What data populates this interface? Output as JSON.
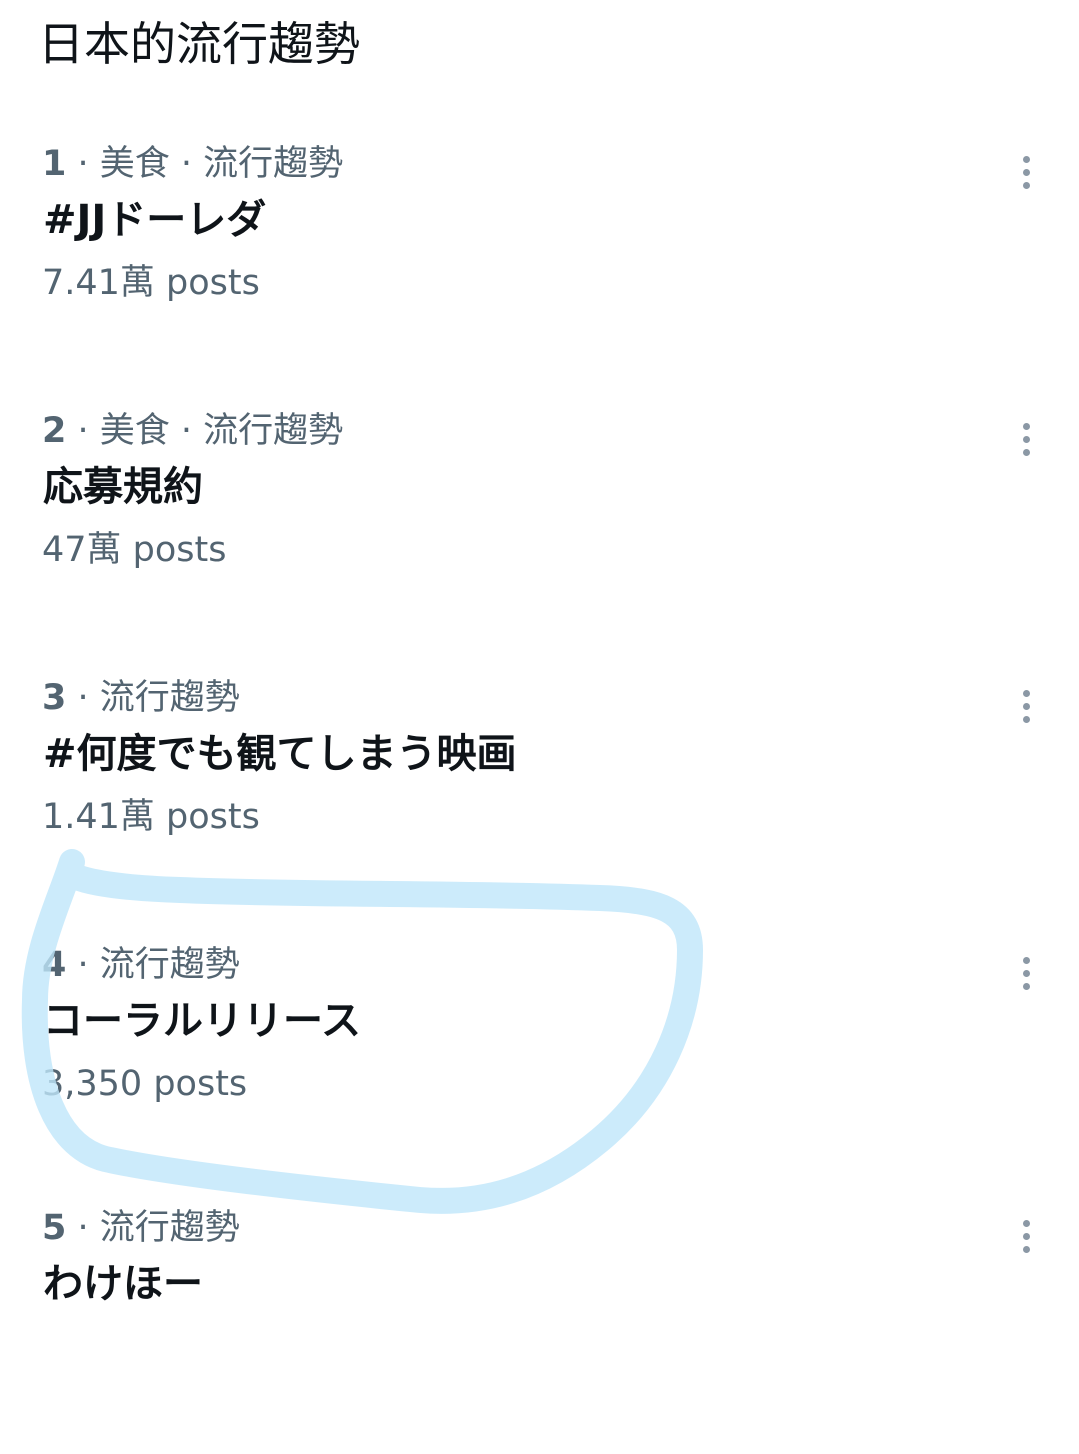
{
  "header": {
    "title": "日本的流行趨勢"
  },
  "trends": [
    {
      "rank": "1",
      "context": "美食 · 流行趨勢",
      "name": "#JJドーレダ",
      "posts": "7.41萬 posts"
    },
    {
      "rank": "2",
      "context": "美食 · 流行趨勢",
      "name": "応募規約",
      "posts": "47萬 posts"
    },
    {
      "rank": "3",
      "context": "流行趨勢",
      "name": "#何度でも観てしまう映画",
      "posts": "1.41萬 posts"
    },
    {
      "rank": "4",
      "context": "流行趨勢",
      "name": "コーラルリリース",
      "posts": "3,350 posts"
    },
    {
      "rank": "5",
      "context": "流行趨勢",
      "name": "わけほー",
      "posts": ""
    }
  ],
  "icons": {
    "more": "more-vertical-icon"
  },
  "colors": {
    "primary_text": "#0f1419",
    "secondary_text": "#536471",
    "more_icon": "#8b98a5",
    "highlight_stroke": "#bfe6fa"
  }
}
